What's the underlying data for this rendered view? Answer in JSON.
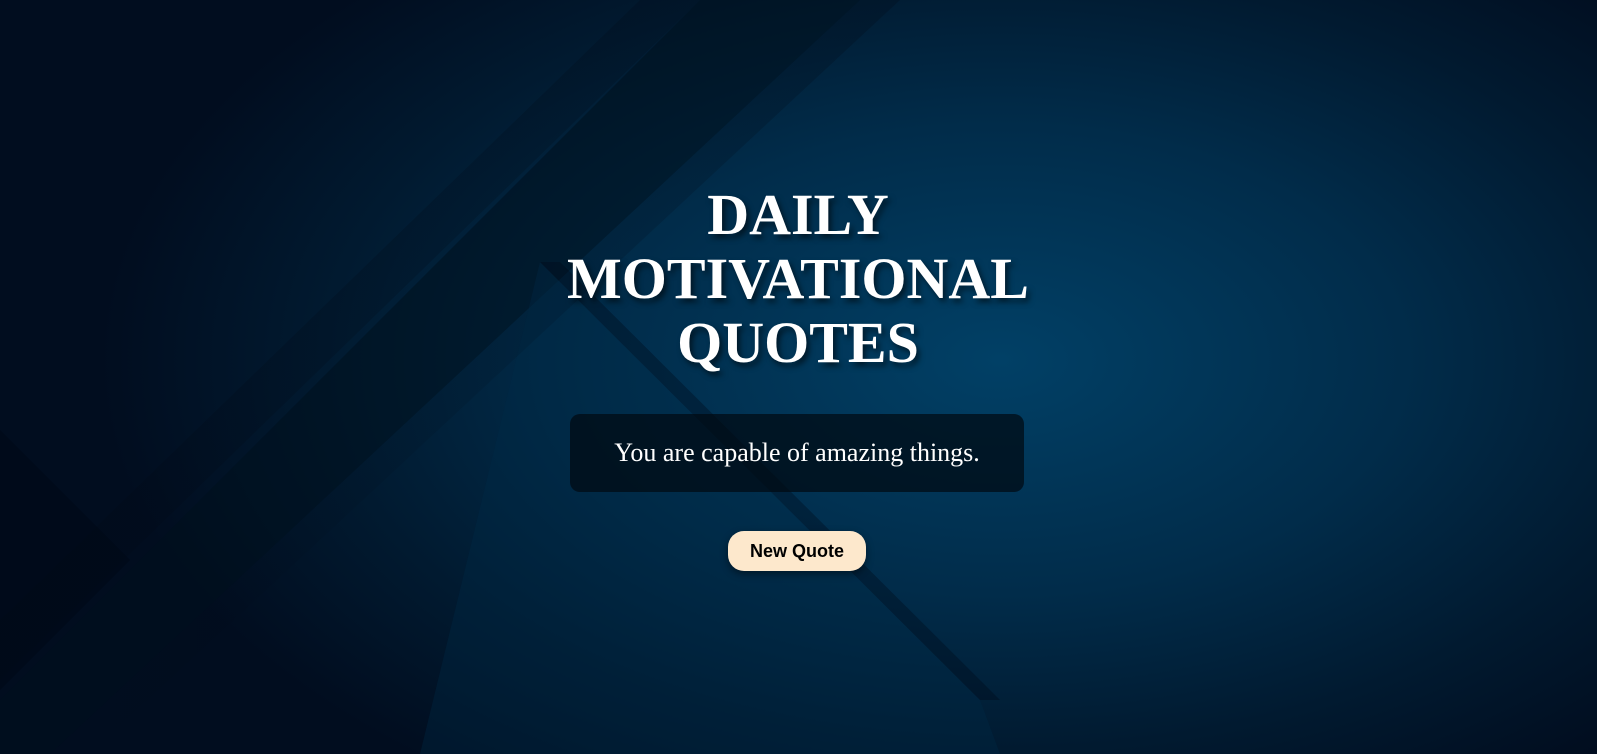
{
  "page": {
    "title_lines": [
      "DAILY",
      "MOTIVATIONAL",
      "QUOTES"
    ],
    "quote": "You are capable of amazing things.",
    "button_label": "New Quote"
  },
  "colors": {
    "background": "#013a5e",
    "button_bg": "#fde8cc",
    "quote_box_bg": "#00111c",
    "text": "#ffffff"
  }
}
